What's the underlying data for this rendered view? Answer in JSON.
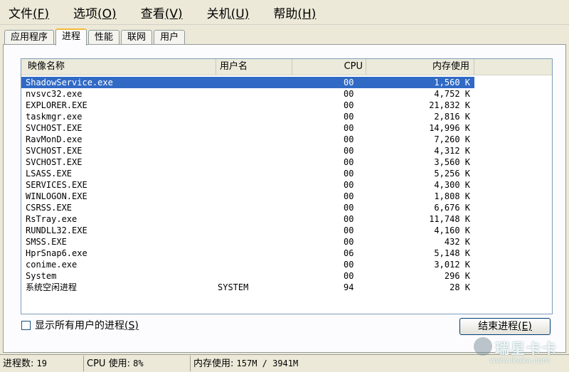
{
  "menu": [
    {
      "label": "文件",
      "accel": "(F)"
    },
    {
      "label": "选项",
      "accel": "(O)"
    },
    {
      "label": "查看",
      "accel": "(V)"
    },
    {
      "label": "关机",
      "accel": "(U)"
    },
    {
      "label": "帮助",
      "accel": "(H)"
    }
  ],
  "tabs": [
    {
      "label": "应用程序",
      "active": false
    },
    {
      "label": "进程",
      "active": true
    },
    {
      "label": "性能",
      "active": false
    },
    {
      "label": "联网",
      "active": false
    },
    {
      "label": "用户",
      "active": false
    }
  ],
  "columns": {
    "name": "映像名称",
    "user": "用户名",
    "cpu": "CPU",
    "mem": "内存使用"
  },
  "processes": [
    {
      "name": "ShadowService.exe",
      "user": "",
      "cpu": "00",
      "mem": "1,560 K",
      "selected": true
    },
    {
      "name": "nvsvc32.exe",
      "user": "",
      "cpu": "00",
      "mem": "4,752 K"
    },
    {
      "name": "EXPLORER.EXE",
      "user": "",
      "cpu": "00",
      "mem": "21,832 K"
    },
    {
      "name": "taskmgr.exe",
      "user": "",
      "cpu": "00",
      "mem": "2,816 K"
    },
    {
      "name": "SVCHOST.EXE",
      "user": "",
      "cpu": "00",
      "mem": "14,996 K"
    },
    {
      "name": "RavMonD.exe",
      "user": "",
      "cpu": "00",
      "mem": "7,260 K"
    },
    {
      "name": "SVCHOST.EXE",
      "user": "",
      "cpu": "00",
      "mem": "4,312 K"
    },
    {
      "name": "SVCHOST.EXE",
      "user": "",
      "cpu": "00",
      "mem": "3,560 K"
    },
    {
      "name": "LSASS.EXE",
      "user": "",
      "cpu": "00",
      "mem": "5,256 K"
    },
    {
      "name": "SERVICES.EXE",
      "user": "",
      "cpu": "00",
      "mem": "4,300 K"
    },
    {
      "name": "WINLOGON.EXE",
      "user": "",
      "cpu": "00",
      "mem": "1,808 K"
    },
    {
      "name": "CSRSS.EXE",
      "user": "",
      "cpu": "00",
      "mem": "6,676 K"
    },
    {
      "name": "RsTray.exe",
      "user": "",
      "cpu": "00",
      "mem": "11,748 K"
    },
    {
      "name": "RUNDLL32.EXE",
      "user": "",
      "cpu": "00",
      "mem": "4,160 K"
    },
    {
      "name": "SMSS.EXE",
      "user": "",
      "cpu": "00",
      "mem": "432 K"
    },
    {
      "name": "HprSnap6.exe",
      "user": "",
      "cpu": "06",
      "mem": "5,148 K"
    },
    {
      "name": "conime.exe",
      "user": "",
      "cpu": "00",
      "mem": "3,012 K"
    },
    {
      "name": "System",
      "user": "",
      "cpu": "00",
      "mem": "296 K"
    },
    {
      "name": "系统空闲进程",
      "user": "SYSTEM",
      "cpu": "94",
      "mem": "28 K"
    }
  ],
  "show_all": {
    "label": "显示所有用户的进程",
    "accel": "(S)",
    "checked": false
  },
  "end_button": {
    "label": "结束进程",
    "accel": "(E)"
  },
  "status": {
    "procs_label": "进程数:",
    "procs_value": "19",
    "cpu_label": "CPU 使用:",
    "cpu_value": "8%",
    "mem_label": "内存使用:",
    "mem_value": "157M / 3941M"
  },
  "watermark": {
    "text": "瑞星卡卡",
    "url": "www.ikaka.com"
  },
  "colors": {
    "selection": "#316ac5",
    "active_tab_accent": "#f7b83a",
    "window_bg": "#ece9d8"
  }
}
